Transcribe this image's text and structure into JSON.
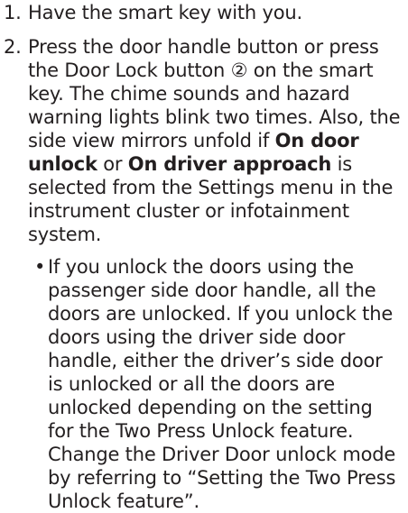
{
  "steps": [
    {
      "number": "1.",
      "text": "Have the smart key with you."
    },
    {
      "number": "2.",
      "text_a": "Press the door handle button or press the Door Lock button ② on the smart key. The chime sounds and hazard warning lights blink two times. Also, the side view mirrors unfold if ",
      "bold_a": "On door unlock",
      "text_b": " or ",
      "bold_b": "On driver approach",
      "text_c": " is selected from the Settings menu in the instrument cluster or infotainment system."
    }
  ],
  "bullet": {
    "mark": "•",
    "text": "If you unlock the doors using the passenger side door handle, all the doors are unlocked. If you unlock the doors using the driver side door handle, either the driver’s side door is unlocked or all the doors are unlocked depending on the setting for the Two Press Unlock feature. Change the Driver Door unlock mode by referring to “Setting the Two Press Unlock feature”."
  }
}
